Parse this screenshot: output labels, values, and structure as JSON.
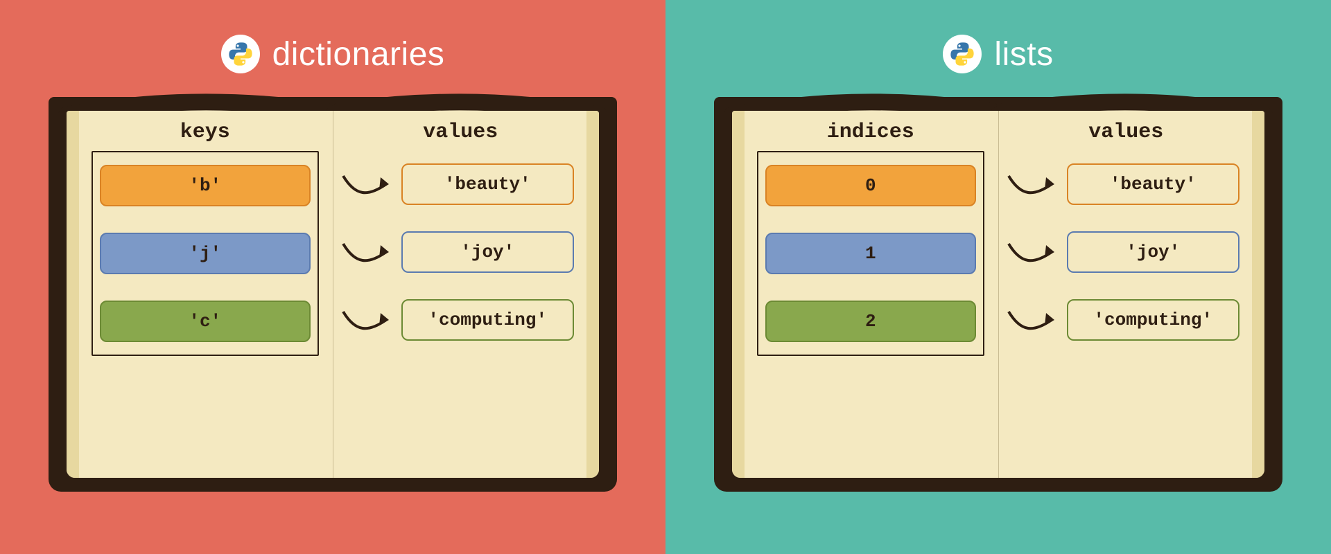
{
  "panels": {
    "left": {
      "title": "dictionaries",
      "bg": "#e46b5b",
      "leftHeader": "keys",
      "rightHeader": "values",
      "rows": [
        {
          "left": "'b'",
          "right": "'beauty'",
          "color": "orange"
        },
        {
          "left": "'j'",
          "right": "'joy'",
          "color": "blue"
        },
        {
          "left": "'c'",
          "right": "'computing'",
          "color": "green"
        }
      ]
    },
    "right": {
      "title": "lists",
      "bg": "#58bba9",
      "leftHeader": "indices",
      "rightHeader": "values",
      "rows": [
        {
          "left": "0",
          "right": "'beauty'",
          "color": "orange"
        },
        {
          "left": "1",
          "right": "'joy'",
          "color": "blue"
        },
        {
          "left": "2",
          "right": "'computing'",
          "color": "green"
        }
      ]
    }
  },
  "icon": "python-logo"
}
